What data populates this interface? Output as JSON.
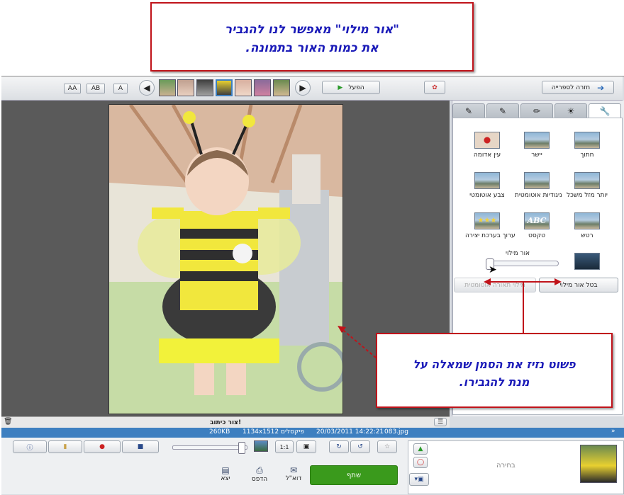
{
  "callouts": {
    "top": {
      "line1": "\"אור מילוי\" מאפשר לנו להגביר",
      "line2": "את כמות האור בתמונה."
    },
    "bottom": {
      "line1": "פשוט נזיז את הסמן שמאלה על",
      "line2": "מנת להגבירו."
    }
  },
  "toolbar": {
    "view_buttons": [
      "AA",
      "AB",
      "A"
    ],
    "play_label": "הפעל",
    "back_label": "חזרה לספרייה"
  },
  "panel": {
    "tools": [
      {
        "label": "חתוך",
        "icon": "crop-icon"
      },
      {
        "label": "יישר",
        "icon": "straighten-icon"
      },
      {
        "label": "עין אדומה",
        "icon": "red-eye-icon"
      },
      {
        "label": "יותר מזל משכל",
        "icon": "im-feeling-lucky-icon"
      },
      {
        "label": "ניגודיות אוטומטית",
        "icon": "auto-contrast-icon"
      },
      {
        "label": "צבע אוטומטי",
        "icon": "auto-color-icon"
      },
      {
        "label": "רטש",
        "icon": "retouch-icon"
      },
      {
        "label": "טקסט",
        "icon": "text-icon"
      },
      {
        "label": "ערוך בערכת יצירה",
        "icon": "edit-creative-kit-icon"
      }
    ],
    "fill_light_label": "אור מילוי",
    "fill_light_value": 0.0,
    "cancel_fill_light": "בטל אור מילוי",
    "auto_fill_light": "מילוי תאורה אוטומטית"
  },
  "caption": "צור כיתוב!",
  "info": {
    "filename": "083.jpg",
    "datetime": "20/03/2011  14:22:21",
    "dimensions": "1134x1512 פיקסלים",
    "size": "260KB"
  },
  "bottom": {
    "selection_label": "בחירה",
    "share_label": "שתף",
    "email_label": "דוא\"ל",
    "print_label": "הדפס",
    "export_label": "יצא",
    "zoom_value": 0.95
  },
  "colors": {
    "accent": "#3d7fc0",
    "share_green": "#3a9a1c",
    "callout_border": "#c0131a",
    "callout_text": "#1a1ab8"
  }
}
